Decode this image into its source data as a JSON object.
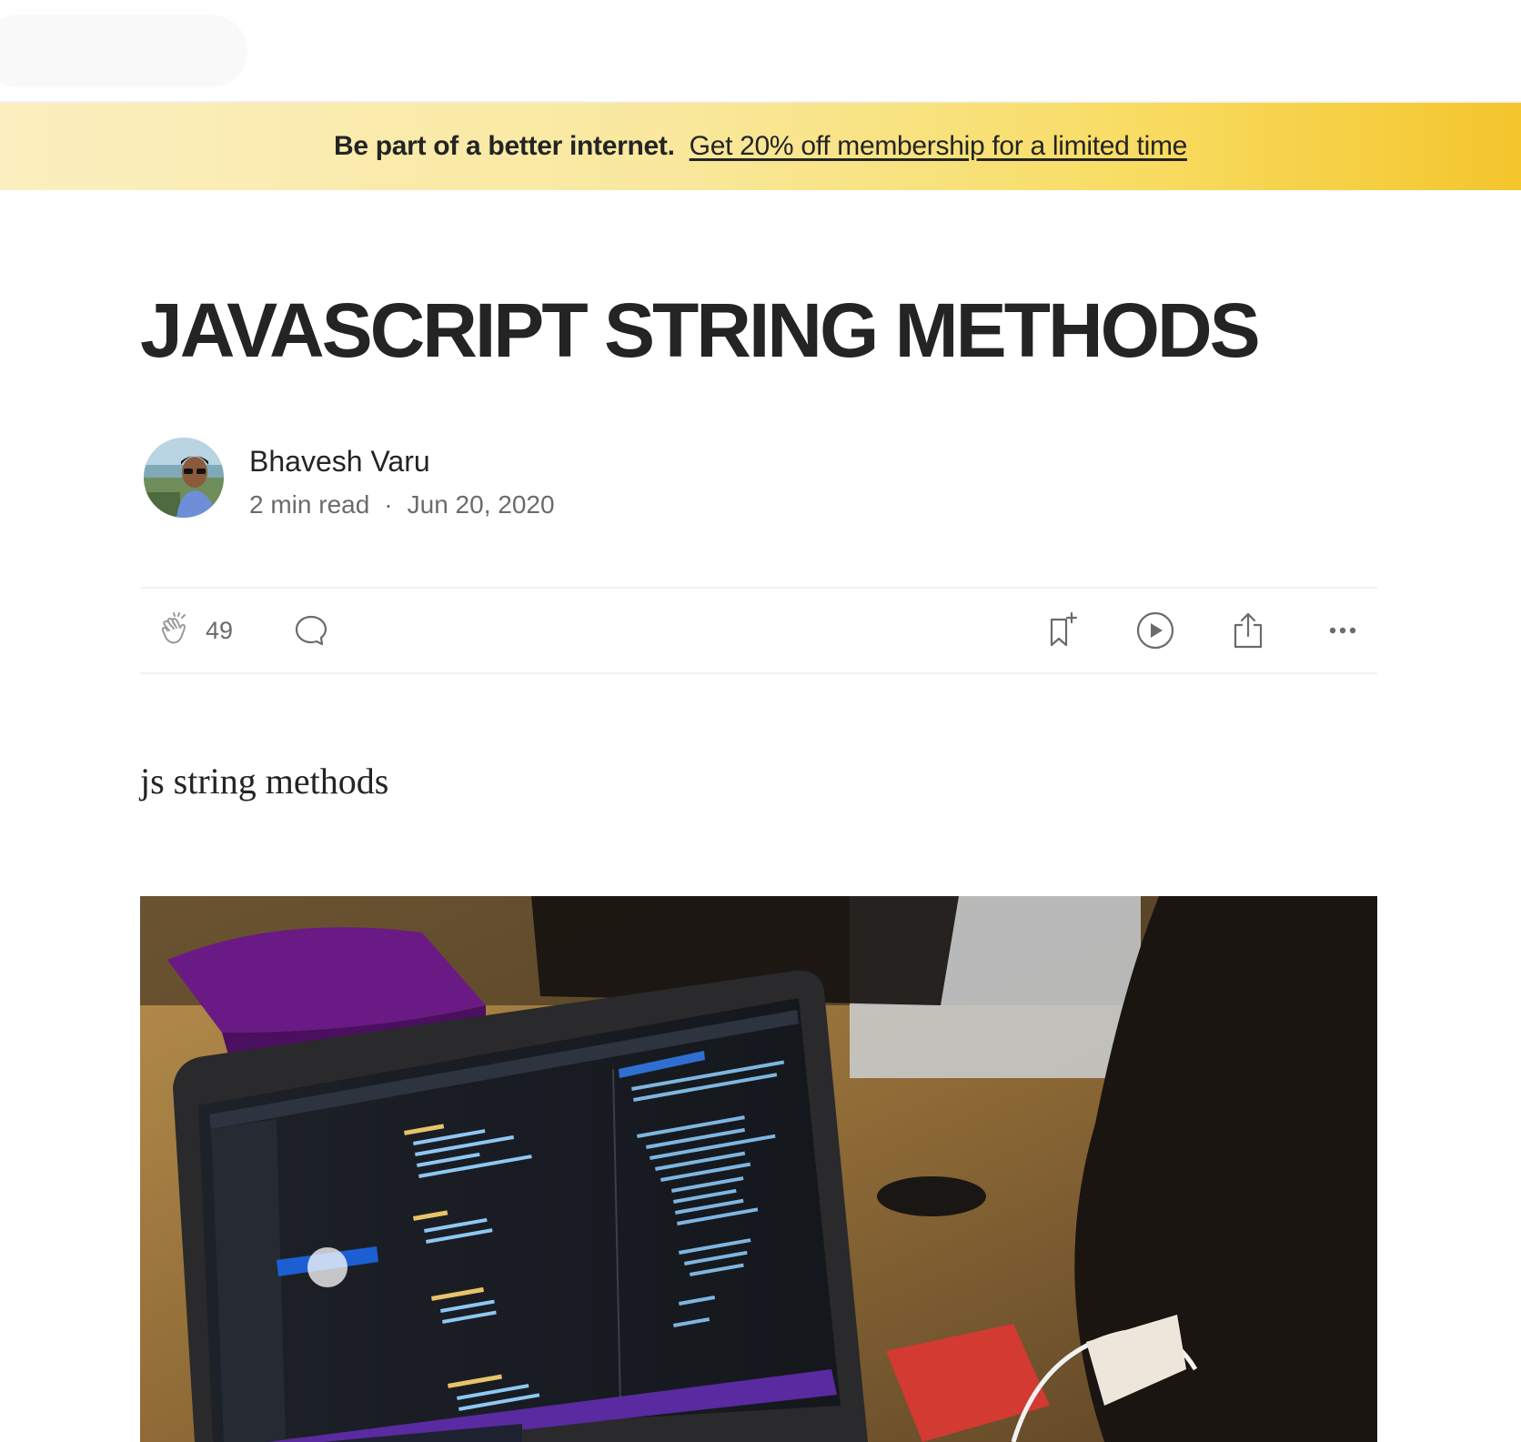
{
  "banner": {
    "lead": "Be part of a better internet.",
    "link": "Get 20% off membership for a limited time"
  },
  "article": {
    "title": "JAVASCRIPT STRING METHODS",
    "subtitle": "js string methods",
    "author": {
      "name": "Bhavesh Varu",
      "read_time": "2 min read",
      "separator": "·",
      "date": "Jun 20, 2020"
    }
  },
  "actions": {
    "clap_count": "49",
    "icons": [
      "clap-icon",
      "comment-icon",
      "bookmark-icon",
      "play-icon",
      "share-icon",
      "more-icon"
    ]
  },
  "colors": {
    "text": "#242424",
    "muted": "#6b6b6b",
    "banner_start": "#fbefc0",
    "banner_end": "#f4c52c"
  }
}
